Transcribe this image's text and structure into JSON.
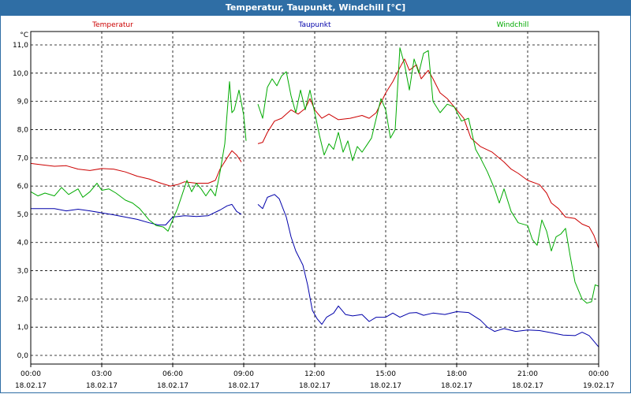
{
  "window": {
    "title": "Temperatur, Taupunkt, Windchill [°C]"
  },
  "chart_data": {
    "type": "line",
    "unit_label": "°C",
    "ylim": [
      0,
      11
    ],
    "xlim": [
      0,
      24
    ],
    "grid": true,
    "y_ticks": [
      "0,0",
      "1,0",
      "2,0",
      "3,0",
      "4,0",
      "5,0",
      "6,0",
      "7,0",
      "8,0",
      "9,0",
      "10,0",
      "11,0"
    ],
    "x_ticks": [
      {
        "time": "00:00",
        "date": "18.02.17"
      },
      {
        "time": "03:00",
        "date": "18.02.17"
      },
      {
        "time": "06:00",
        "date": "18.02.17"
      },
      {
        "time": "09:00",
        "date": "18.02.17"
      },
      {
        "time": "12:00",
        "date": "18.02.17"
      },
      {
        "time": "15:00",
        "date": "18.02.17"
      },
      {
        "time": "18:00",
        "date": "18.02.17"
      },
      {
        "time": "21:00",
        "date": "18.02.17"
      },
      {
        "time": "00:00",
        "date": "19.02.17"
      }
    ],
    "series": [
      {
        "name": "Temperatur",
        "color": "#cc0000",
        "segments": [
          [
            [
              0,
              6.8
            ],
            [
              0.5,
              6.75
            ],
            [
              1,
              6.7
            ],
            [
              1.5,
              6.72
            ],
            [
              2,
              6.6
            ],
            [
              2.5,
              6.55
            ],
            [
              3,
              6.62
            ],
            [
              3.5,
              6.6
            ],
            [
              4,
              6.5
            ],
            [
              4.5,
              6.35
            ],
            [
              5,
              6.25
            ],
            [
              5.5,
              6.1
            ],
            [
              5.9,
              6.0
            ],
            [
              6.2,
              6.05
            ],
            [
              6.5,
              6.15
            ],
            [
              7,
              6.1
            ],
            [
              7.5,
              6.1
            ],
            [
              7.8,
              6.2
            ],
            [
              8,
              6.6
            ],
            [
              8.3,
              7.0
            ],
            [
              8.5,
              7.25
            ],
            [
              8.7,
              7.1
            ],
            [
              8.9,
              6.85
            ]
          ],
          [
            [
              9.6,
              7.5
            ],
            [
              9.8,
              7.55
            ],
            [
              10,
              7.9
            ],
            [
              10.3,
              8.3
            ],
            [
              10.6,
              8.4
            ],
            [
              11,
              8.7
            ],
            [
              11.3,
              8.55
            ],
            [
              11.6,
              8.75
            ],
            [
              11.8,
              9.1
            ],
            [
              12,
              8.7
            ],
            [
              12.3,
              8.4
            ],
            [
              12.6,
              8.55
            ],
            [
              13,
              8.35
            ],
            [
              13.5,
              8.4
            ],
            [
              14,
              8.5
            ],
            [
              14.3,
              8.4
            ],
            [
              14.6,
              8.6
            ],
            [
              15,
              9.3
            ],
            [
              15.3,
              9.7
            ],
            [
              15.6,
              10.2
            ],
            [
              15.8,
              10.5
            ],
            [
              16,
              10.1
            ],
            [
              16.3,
              10.3
            ],
            [
              16.5,
              9.8
            ],
            [
              16.8,
              10.1
            ],
            [
              17,
              9.8
            ],
            [
              17.3,
              9.3
            ],
            [
              17.6,
              9.1
            ],
            [
              18,
              8.7
            ],
            [
              18.3,
              8.4
            ],
            [
              18.6,
              7.7
            ],
            [
              19,
              7.4
            ],
            [
              19.5,
              7.2
            ],
            [
              20,
              6.85
            ],
            [
              20.3,
              6.6
            ],
            [
              20.6,
              6.45
            ],
            [
              21,
              6.2
            ],
            [
              21.5,
              6.05
            ],
            [
              21.8,
              5.75
            ],
            [
              22,
              5.4
            ],
            [
              22.3,
              5.2
            ],
            [
              22.6,
              4.9
            ],
            [
              23,
              4.85
            ],
            [
              23.3,
              4.65
            ],
            [
              23.6,
              4.55
            ],
            [
              23.8,
              4.25
            ],
            [
              24,
              3.8
            ]
          ]
        ]
      },
      {
        "name": "Taupunkt",
        "color": "#0000aa",
        "segments": [
          [
            [
              0,
              5.2
            ],
            [
              1,
              5.2
            ],
            [
              1.5,
              5.12
            ],
            [
              2,
              5.18
            ],
            [
              2.5,
              5.12
            ],
            [
              3,
              5.05
            ],
            [
              3.5,
              4.98
            ],
            [
              4,
              4.9
            ],
            [
              4.5,
              4.82
            ],
            [
              5,
              4.7
            ],
            [
              5.4,
              4.62
            ],
            [
              5.7,
              4.62
            ],
            [
              6,
              4.9
            ],
            [
              6.5,
              4.95
            ],
            [
              7,
              4.92
            ],
            [
              7.5,
              4.95
            ],
            [
              8,
              5.15
            ],
            [
              8.3,
              5.3
            ],
            [
              8.5,
              5.35
            ],
            [
              8.7,
              5.1
            ],
            [
              8.9,
              5.0
            ]
          ],
          [
            [
              9.6,
              5.35
            ],
            [
              9.8,
              5.2
            ],
            [
              10,
              5.6
            ],
            [
              10.3,
              5.7
            ],
            [
              10.5,
              5.55
            ],
            [
              10.8,
              4.9
            ],
            [
              11,
              4.2
            ],
            [
              11.2,
              3.7
            ],
            [
              11.5,
              3.2
            ],
            [
              11.7,
              2.5
            ],
            [
              11.9,
              1.6
            ],
            [
              12.1,
              1.3
            ],
            [
              12.3,
              1.1
            ],
            [
              12.5,
              1.35
            ],
            [
              12.8,
              1.5
            ],
            [
              13,
              1.75
            ],
            [
              13.3,
              1.45
            ],
            [
              13.6,
              1.4
            ],
            [
              14,
              1.45
            ],
            [
              14.3,
              1.2
            ],
            [
              14.6,
              1.35
            ],
            [
              15,
              1.35
            ],
            [
              15.3,
              1.5
            ],
            [
              15.6,
              1.35
            ],
            [
              16,
              1.5
            ],
            [
              16.3,
              1.52
            ],
            [
              16.6,
              1.42
            ],
            [
              17,
              1.5
            ],
            [
              17.5,
              1.45
            ],
            [
              18,
              1.55
            ],
            [
              18.5,
              1.52
            ],
            [
              19,
              1.25
            ],
            [
              19.3,
              1.0
            ],
            [
              19.6,
              0.85
            ],
            [
              20,
              0.95
            ],
            [
              20.5,
              0.85
            ],
            [
              21,
              0.9
            ],
            [
              21.5,
              0.88
            ],
            [
              22,
              0.8
            ],
            [
              22.5,
              0.72
            ],
            [
              23,
              0.7
            ],
            [
              23.3,
              0.82
            ],
            [
              23.6,
              0.7
            ],
            [
              23.8,
              0.5
            ],
            [
              24,
              0.3
            ]
          ]
        ]
      },
      {
        "name": "Windchill",
        "color": "#00aa00",
        "segments": [
          [
            [
              0,
              5.8
            ],
            [
              0.3,
              5.65
            ],
            [
              0.6,
              5.75
            ],
            [
              1,
              5.65
            ],
            [
              1.3,
              5.95
            ],
            [
              1.6,
              5.7
            ],
            [
              2,
              5.9
            ],
            [
              2.2,
              5.6
            ],
            [
              2.5,
              5.8
            ],
            [
              2.8,
              6.1
            ],
            [
              3,
              5.85
            ],
            [
              3.3,
              5.9
            ],
            [
              3.6,
              5.75
            ],
            [
              4,
              5.5
            ],
            [
              4.3,
              5.4
            ],
            [
              4.6,
              5.2
            ],
            [
              5,
              4.8
            ],
            [
              5.3,
              4.6
            ],
            [
              5.6,
              4.55
            ],
            [
              5.8,
              4.4
            ],
            [
              6,
              4.8
            ],
            [
              6.2,
              5.2
            ],
            [
              6.4,
              5.7
            ],
            [
              6.6,
              6.2
            ],
            [
              6.8,
              5.8
            ],
            [
              7,
              6.1
            ],
            [
              7.2,
              5.9
            ],
            [
              7.4,
              5.65
            ],
            [
              7.6,
              5.9
            ],
            [
              7.8,
              5.65
            ],
            [
              8,
              6.5
            ],
            [
              8.2,
              7.5
            ],
            [
              8.4,
              9.7
            ],
            [
              8.5,
              8.6
            ],
            [
              8.6,
              8.7
            ],
            [
              8.8,
              9.4
            ],
            [
              9.0,
              8.5
            ],
            [
              9.1,
              7.6
            ]
          ],
          [
            [
              9.6,
              8.9
            ],
            [
              9.8,
              8.4
            ],
            [
              10,
              9.5
            ],
            [
              10.2,
              9.8
            ],
            [
              10.4,
              9.55
            ],
            [
              10.6,
              9.9
            ],
            [
              10.8,
              10.05
            ],
            [
              11,
              9.2
            ],
            [
              11.2,
              8.6
            ],
            [
              11.4,
              9.4
            ],
            [
              11.6,
              8.7
            ],
            [
              11.8,
              9.4
            ],
            [
              12,
              8.6
            ],
            [
              12.2,
              7.8
            ],
            [
              12.4,
              7.1
            ],
            [
              12.6,
              7.5
            ],
            [
              12.8,
              7.3
            ],
            [
              13,
              7.9
            ],
            [
              13.2,
              7.2
            ],
            [
              13.4,
              7.6
            ],
            [
              13.6,
              6.9
            ],
            [
              13.8,
              7.4
            ],
            [
              14,
              7.2
            ],
            [
              14.2,
              7.45
            ],
            [
              14.4,
              7.7
            ],
            [
              14.6,
              8.4
            ],
            [
              14.8,
              9.1
            ],
            [
              15,
              8.7
            ],
            [
              15.2,
              7.7
            ],
            [
              15.4,
              8.0
            ],
            [
              15.6,
              10.9
            ],
            [
              15.8,
              10.3
            ],
            [
              16,
              9.4
            ],
            [
              16.2,
              10.5
            ],
            [
              16.4,
              10.0
            ],
            [
              16.6,
              10.7
            ],
            [
              16.8,
              10.8
            ],
            [
              17,
              9.0
            ],
            [
              17.3,
              8.6
            ],
            [
              17.6,
              8.9
            ],
            [
              17.9,
              8.8
            ],
            [
              18.2,
              8.3
            ],
            [
              18.5,
              8.4
            ],
            [
              18.8,
              7.3
            ],
            [
              19,
              7.0
            ],
            [
              19.3,
              6.5
            ],
            [
              19.6,
              5.9
            ],
            [
              19.8,
              5.4
            ],
            [
              20,
              5.9
            ],
            [
              20.3,
              5.1
            ],
            [
              20.6,
              4.7
            ],
            [
              21,
              4.6
            ],
            [
              21.2,
              4.1
            ],
            [
              21.4,
              3.9
            ],
            [
              21.6,
              4.8
            ],
            [
              21.8,
              4.4
            ],
            [
              22,
              3.7
            ],
            [
              22.2,
              4.2
            ],
            [
              22.4,
              4.3
            ],
            [
              22.6,
              4.5
            ],
            [
              22.8,
              3.5
            ],
            [
              23,
              2.6
            ],
            [
              23.3,
              2.0
            ],
            [
              23.5,
              1.85
            ],
            [
              23.7,
              1.9
            ],
            [
              23.85,
              2.5
            ],
            [
              24,
              2.45
            ]
          ]
        ]
      }
    ]
  }
}
